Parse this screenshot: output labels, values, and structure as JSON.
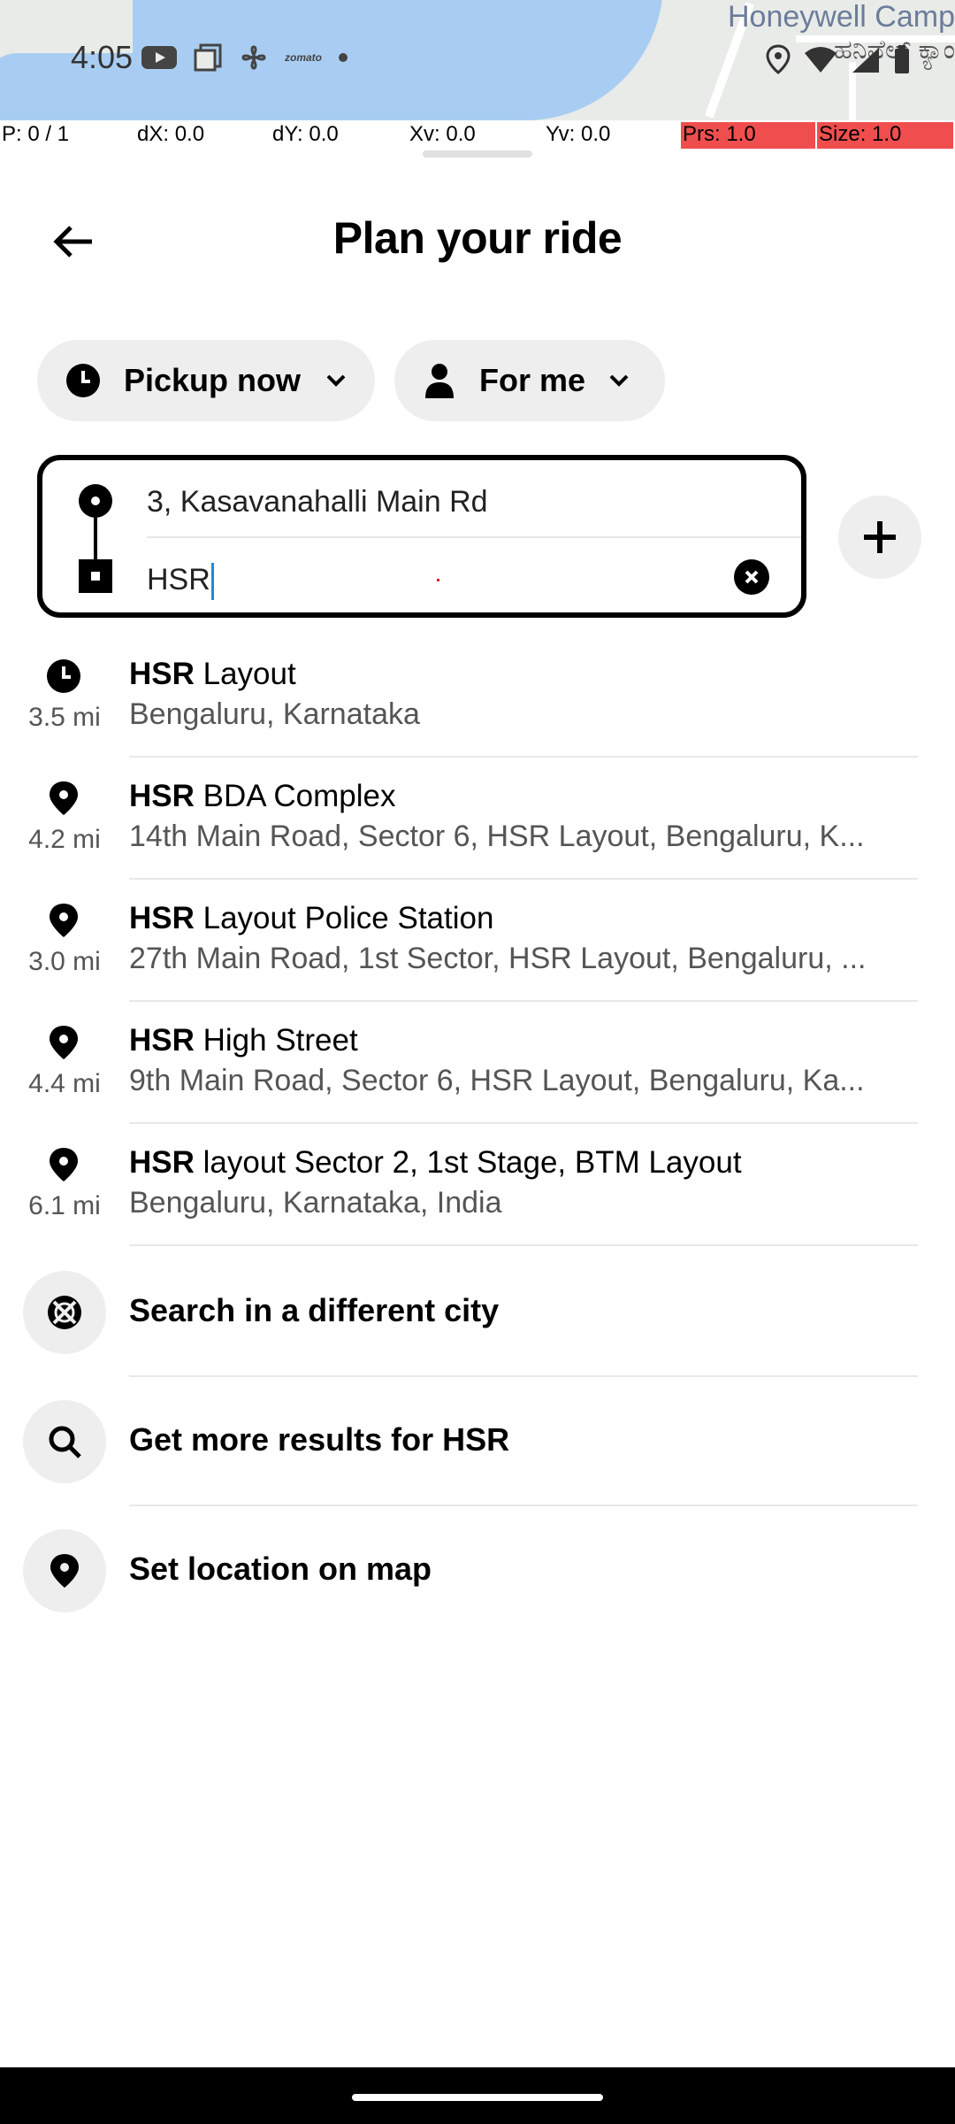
{
  "status_bar": {
    "time": "4:05",
    "notif_icons": [
      "youtube-icon",
      "copy-icon",
      "fan-icon",
      "zomato-icon"
    ],
    "zomato_text": "zomato"
  },
  "map": {
    "label_en": "Honeywell Camp",
    "label_kn": "ಹನಿವೆಲ್ ಕ್ಯಾಂ"
  },
  "debug": {
    "p": "P: 0 / 1",
    "dx": "dX: 0.0",
    "dy": "dY: 0.0",
    "xv": "Xv: 0.0",
    "yv": "Yv: 0.0",
    "prs": "Prs: 1.0",
    "size": "Size: 1.0",
    "highlight_color": "#f04e4e"
  },
  "header": {
    "title": "Plan your ride"
  },
  "pills": {
    "pickup_label": "Pickup now",
    "rider_label": "For me"
  },
  "locations": {
    "pickup_value": "3, Kasavanahalli Main Rd",
    "destination_value": "HSR"
  },
  "results": [
    {
      "icon": "clock-icon",
      "distance": "3.5 mi",
      "bold": "HSR",
      "rest": " Layout",
      "subtitle": "Bengaluru, Karnataka"
    },
    {
      "icon": "pin-icon",
      "distance": "4.2 mi",
      "bold": "HSR",
      "rest": " BDA Complex",
      "subtitle": "14th Main Road, Sector 6, HSR Layout, Bengaluru, K..."
    },
    {
      "icon": "pin-icon",
      "distance": "3.0 mi",
      "bold": "HSR",
      "rest": " Layout Police Station",
      "subtitle": "27th Main Road, 1st Sector, HSR Layout, Bengaluru, ..."
    },
    {
      "icon": "pin-icon",
      "distance": "4.4 mi",
      "bold": "HSR",
      "rest": " High Street",
      "subtitle": "9th Main Road, Sector 6, HSR Layout, Bengaluru, Ka..."
    },
    {
      "icon": "pin-icon",
      "distance": "6.1 mi",
      "bold": "HSR",
      "rest": " layout Sector 2, 1st Stage, BTM Layout",
      "subtitle": "Bengaluru, Karnataka, India"
    }
  ],
  "actions": {
    "different_city": "Search in a different city",
    "more_results": "Get more results for HSR",
    "set_on_map": "Set location on map"
  }
}
